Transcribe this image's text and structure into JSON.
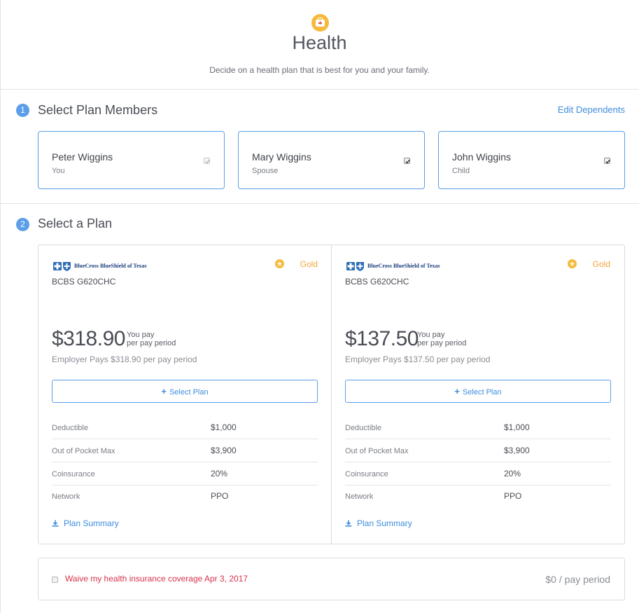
{
  "header": {
    "title": "Health",
    "subtitle": "Decide on a health plan that is best for you and your family."
  },
  "step1": {
    "number": "1",
    "title": "Select Plan Members",
    "edit_link": "Edit Dependents",
    "members": [
      {
        "name": "Peter Wiggins",
        "relation": "You",
        "checked": true,
        "disabled": true
      },
      {
        "name": "Mary Wiggins",
        "relation": "Spouse",
        "checked": true,
        "disabled": false
      },
      {
        "name": "John Wiggins",
        "relation": "Child",
        "checked": true,
        "disabled": false
      }
    ]
  },
  "step2": {
    "number": "2",
    "title": "Select a Plan",
    "plans": [
      {
        "carrier": "BlueCross BlueShield of Texas",
        "tier": "Gold",
        "plan_name": "BCBS G620CHC",
        "price": "$318.90",
        "price_note_1": "You pay",
        "price_note_2": "per pay period",
        "employer_pays": "Employer Pays $318.90 per pay period",
        "select_label": "Select Plan",
        "details": [
          {
            "label": "Deductible",
            "value": "$1,000"
          },
          {
            "label": "Out of Pocket Max",
            "value": "$3,900"
          },
          {
            "label": "Coinsurance",
            "value": "20%"
          },
          {
            "label": "Network",
            "value": "PPO"
          }
        ],
        "summary_label": "Plan Summary"
      },
      {
        "carrier": "BlueCross BlueShield of Texas",
        "tier": "Gold",
        "plan_name": "BCBS G620CHC",
        "price": "$137.50",
        "price_note_1": "You pay",
        "price_note_2": "per pay period",
        "employer_pays": "Employer Pays $137.50 per pay period",
        "select_label": "Select Plan",
        "details": [
          {
            "label": "Deductible",
            "value": "$1,000"
          },
          {
            "label": "Out of Pocket Max",
            "value": "$3,900"
          },
          {
            "label": "Coinsurance",
            "value": "20%"
          },
          {
            "label": "Network",
            "value": "PPO"
          }
        ],
        "summary_label": "Plan Summary"
      }
    ]
  },
  "waive": {
    "label": "Waive my health insurance coverage Apr 3, 2017",
    "cost": "$0 / pay period",
    "checked": false
  },
  "colors": {
    "accent": "#5b9ee9",
    "link": "#3f8ddc",
    "gold": "#f6b93b",
    "waive_red": "#d6334b"
  },
  "icons": {
    "header": "medical-kit-icon",
    "tier": "gold-medal-icon",
    "summary": "download-icon",
    "carrier": "bcbs-logo"
  }
}
